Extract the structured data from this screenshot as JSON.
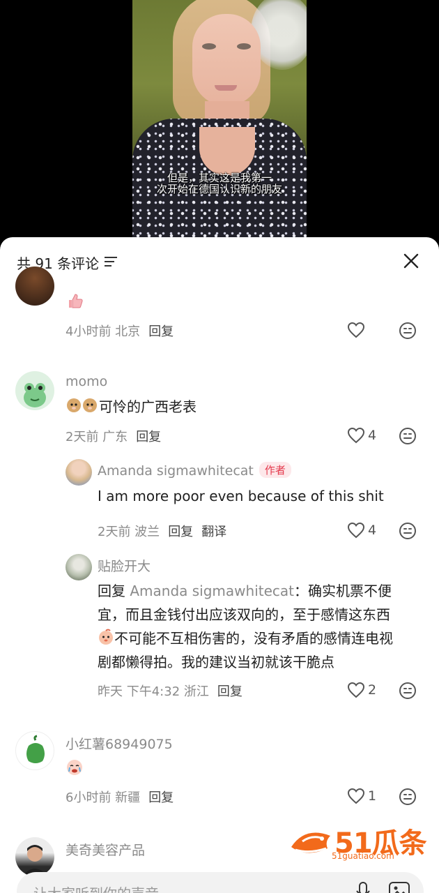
{
  "video": {
    "subtitle_line1": "但是，其实这是我第一",
    "subtitle_line2": "次开始在德国认识新的朋友"
  },
  "header": {
    "comment_count": "共 91 条评论"
  },
  "comments": [
    {
      "text_sticker": "thumbs-up",
      "time_location": "4小时前 北京",
      "reply_label": "回复"
    },
    {
      "username": "momo",
      "text": "可怜的广西老表",
      "time_location": "2天前 广东",
      "reply_label": "回复",
      "likes": "4"
    },
    {
      "username": "Amanda sigmawhitecat",
      "badge": "作者",
      "text": "I am more poor even because of this shit",
      "time_location": "2天前 波兰",
      "reply_label": "回复",
      "translate_label": "翻译",
      "likes": "4"
    },
    {
      "username": "贴脸开大",
      "reply_prefix": "回复",
      "reply_to": "Amanda sigmawhitecat",
      "line1": "：确实机票不便",
      "line2": "宜，而且金钱付出应该双向的，至于感情这东西",
      "line3": "不可能不互相伤害的，没有矛盾的感情连电视",
      "line4": "剧都懒得拍。我的建议当初就该干脆点",
      "time_location": "昨天 下午4:32 浙江",
      "reply_label": "回复",
      "likes": "2"
    },
    {
      "username": "小红薯68949075",
      "time_location": "6小时前 新疆",
      "reply_label": "回复",
      "likes": "1"
    },
    {
      "username": "美奇美容产品"
    }
  ],
  "input": {
    "placeholder": "让大家听到你的声音"
  },
  "watermark": {
    "text": "51瓜条",
    "sub": "51guatiao.com"
  },
  "colors": {
    "accent_red": "#e4394c",
    "watermark_orange": "#f26a1b",
    "meta_gray": "#8a8a8a"
  }
}
